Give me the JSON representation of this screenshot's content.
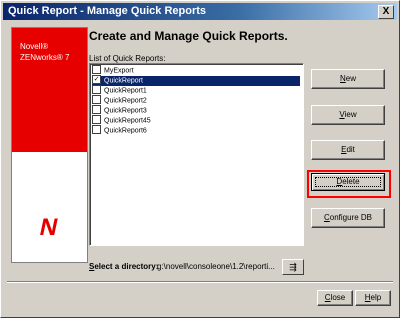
{
  "window": {
    "title": "Quick Report - Manage Quick Reports",
    "close_glyph": "X"
  },
  "brand": {
    "line1": "Novell®",
    "line2": "ZENworks® 7",
    "logo": "N"
  },
  "heading": "Create and Manage Quick Reports.",
  "list": {
    "label": "List of Quick Reports:",
    "items": [
      {
        "label": "MyExport",
        "checked": false,
        "selected": false
      },
      {
        "label": "QuickReport",
        "checked": true,
        "selected": true
      },
      {
        "label": "QuickReport1",
        "checked": false,
        "selected": false
      },
      {
        "label": "QuickReport2",
        "checked": false,
        "selected": false
      },
      {
        "label": "QuickReport3",
        "checked": false,
        "selected": false
      },
      {
        "label": "QuickReport45",
        "checked": false,
        "selected": false
      },
      {
        "label": "QuickReport6",
        "checked": false,
        "selected": false
      }
    ]
  },
  "buttons": {
    "new_first": "N",
    "new_rest": "ew",
    "view_first": "V",
    "view_rest": "iew",
    "edit_first": "E",
    "edit_rest": "dit",
    "delete_first": "D",
    "delete_rest": "elete",
    "configure_first": "C",
    "configure_rest": "onfigure DB",
    "close_first": "C",
    "close_rest": "lose",
    "help_first": "H",
    "help_rest": "elp"
  },
  "directory": {
    "label_first": "S",
    "label_rest": "elect a directory:",
    "path": "g:\\novell\\consoleone\\1.2\\reporti...",
    "browse_glyph": "⇶"
  },
  "colors": {
    "brand_red": "#e60000",
    "selection": "#0a246a",
    "focus_highlight": "#ff0000"
  }
}
